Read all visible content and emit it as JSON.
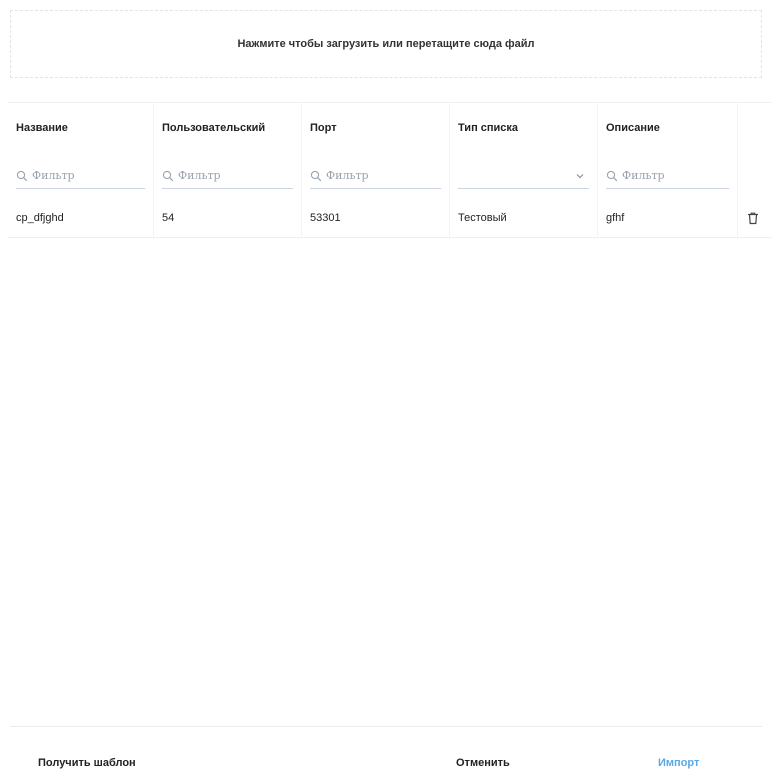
{
  "dropzone": {
    "text": "Нажмите чтобы загрузить или перетащите сюда файл"
  },
  "table": {
    "columns": [
      {
        "label": "Название",
        "filter": "Фильтр"
      },
      {
        "label": "Пользовательский",
        "filter": "Фильтр"
      },
      {
        "label": "Порт",
        "filter": "Фильтр"
      },
      {
        "label": "Тип списка",
        "filter": ""
      },
      {
        "label": "Описание",
        "filter": "Фильтр"
      }
    ],
    "rows": [
      {
        "name": "cp_dfjghd",
        "user": "54",
        "port": "53301",
        "list_type": "Тестовый",
        "description": "gfhf"
      }
    ]
  },
  "footer": {
    "get_template": "Получить шаблон",
    "cancel": "Отменить",
    "import": "Импорт"
  },
  "colors": {
    "accent": "#5aa9e6",
    "filter_underline": "#c9d3e3"
  }
}
